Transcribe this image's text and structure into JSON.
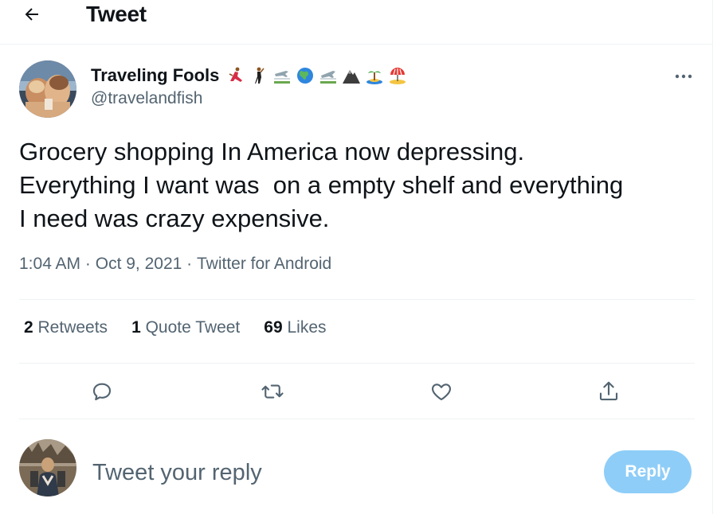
{
  "header": {
    "title": "Tweet",
    "back_icon": "arrow-left-icon"
  },
  "author": {
    "display_name": "Traveling Fools",
    "name_emojis": [
      "💃🏾",
      "🕺🏾",
      "🛬",
      "🌏",
      "🛫",
      "⛰",
      "🏝",
      "🏖"
    ],
    "handle": "@travelandfish"
  },
  "tweet": {
    "text": "Grocery shopping In America now depressing.\nEverything I want was  on a empty shelf and everything\nI need was crazy expensive.",
    "time": "1:04 AM",
    "date": "Oct 9, 2021",
    "source": "Twitter for Android",
    "separator": " · "
  },
  "stats": [
    {
      "count": "2",
      "label": "Retweets"
    },
    {
      "count": "1",
      "label": "Quote Tweet"
    },
    {
      "count": "69",
      "label": "Likes"
    }
  ],
  "actions": [
    "reply-icon",
    "retweet-icon",
    "like-icon",
    "share-icon"
  ],
  "composer": {
    "placeholder": "Tweet your reply",
    "button_label": "Reply"
  },
  "colors": {
    "text": "#0f1419",
    "secondary": "#536471",
    "divider": "#eff3f4",
    "reply_button_disabled": "#8ecdf8"
  }
}
